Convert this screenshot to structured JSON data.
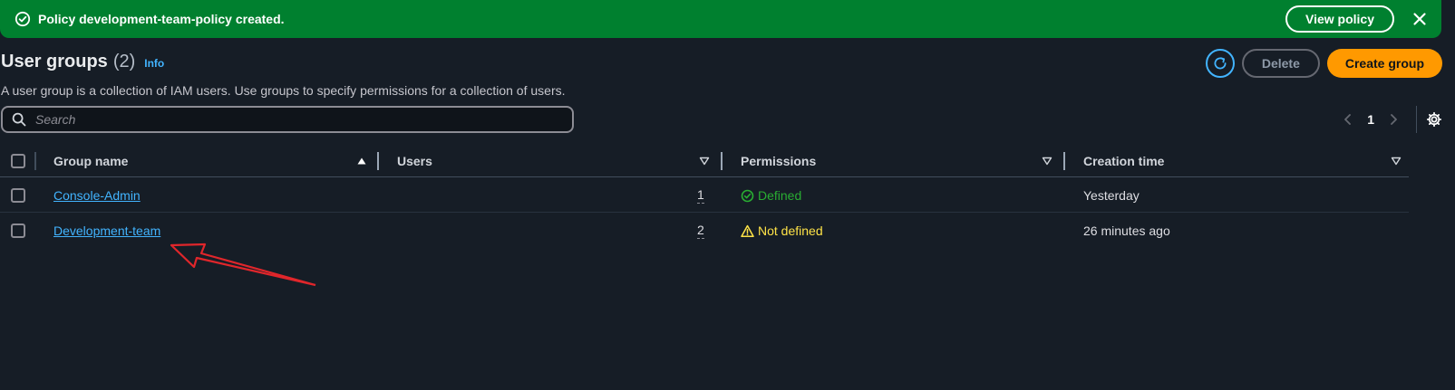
{
  "flash": {
    "message": "Policy development-team-policy created.",
    "view_label": "View policy",
    "success_color": "#00802f"
  },
  "header": {
    "title": "User groups",
    "count": "(2)",
    "info": "Info",
    "description": "A user group is a collection of IAM users. Use groups to specify permissions for a collection of users."
  },
  "actions": {
    "delete_label": "Delete",
    "create_label": "Create group",
    "accent_color": "#ff9900"
  },
  "search": {
    "placeholder": "Search",
    "value": ""
  },
  "pagination": {
    "current_page": "1"
  },
  "table": {
    "columns": {
      "group_name": "Group name",
      "users": "Users",
      "permissions": "Permissions",
      "creation_time": "Creation time"
    },
    "rows": [
      {
        "name": "Console-Admin",
        "users": "1",
        "permissions": "Defined",
        "permissions_status": "success",
        "created": "Yesterday"
      },
      {
        "name": "Development-team",
        "users": "2",
        "permissions": "Not defined",
        "permissions_status": "warning",
        "created": "26 minutes ago"
      }
    ]
  },
  "icons": {
    "flash_status": "check-circle-icon",
    "flash_close": "close-icon",
    "refresh": "refresh-icon",
    "search": "search-icon",
    "prev": "chevron-left-icon",
    "next": "chevron-right-icon",
    "settings": "gear-icon",
    "sort_asc": "caret-up-filled-icon",
    "sort": "caret-down-outline-icon",
    "defined": "check-circle-icon",
    "not_defined": "warning-triangle-icon"
  },
  "annotation": {
    "type": "red-arrow",
    "points_to": "Development-team",
    "color": "#e0262b"
  }
}
